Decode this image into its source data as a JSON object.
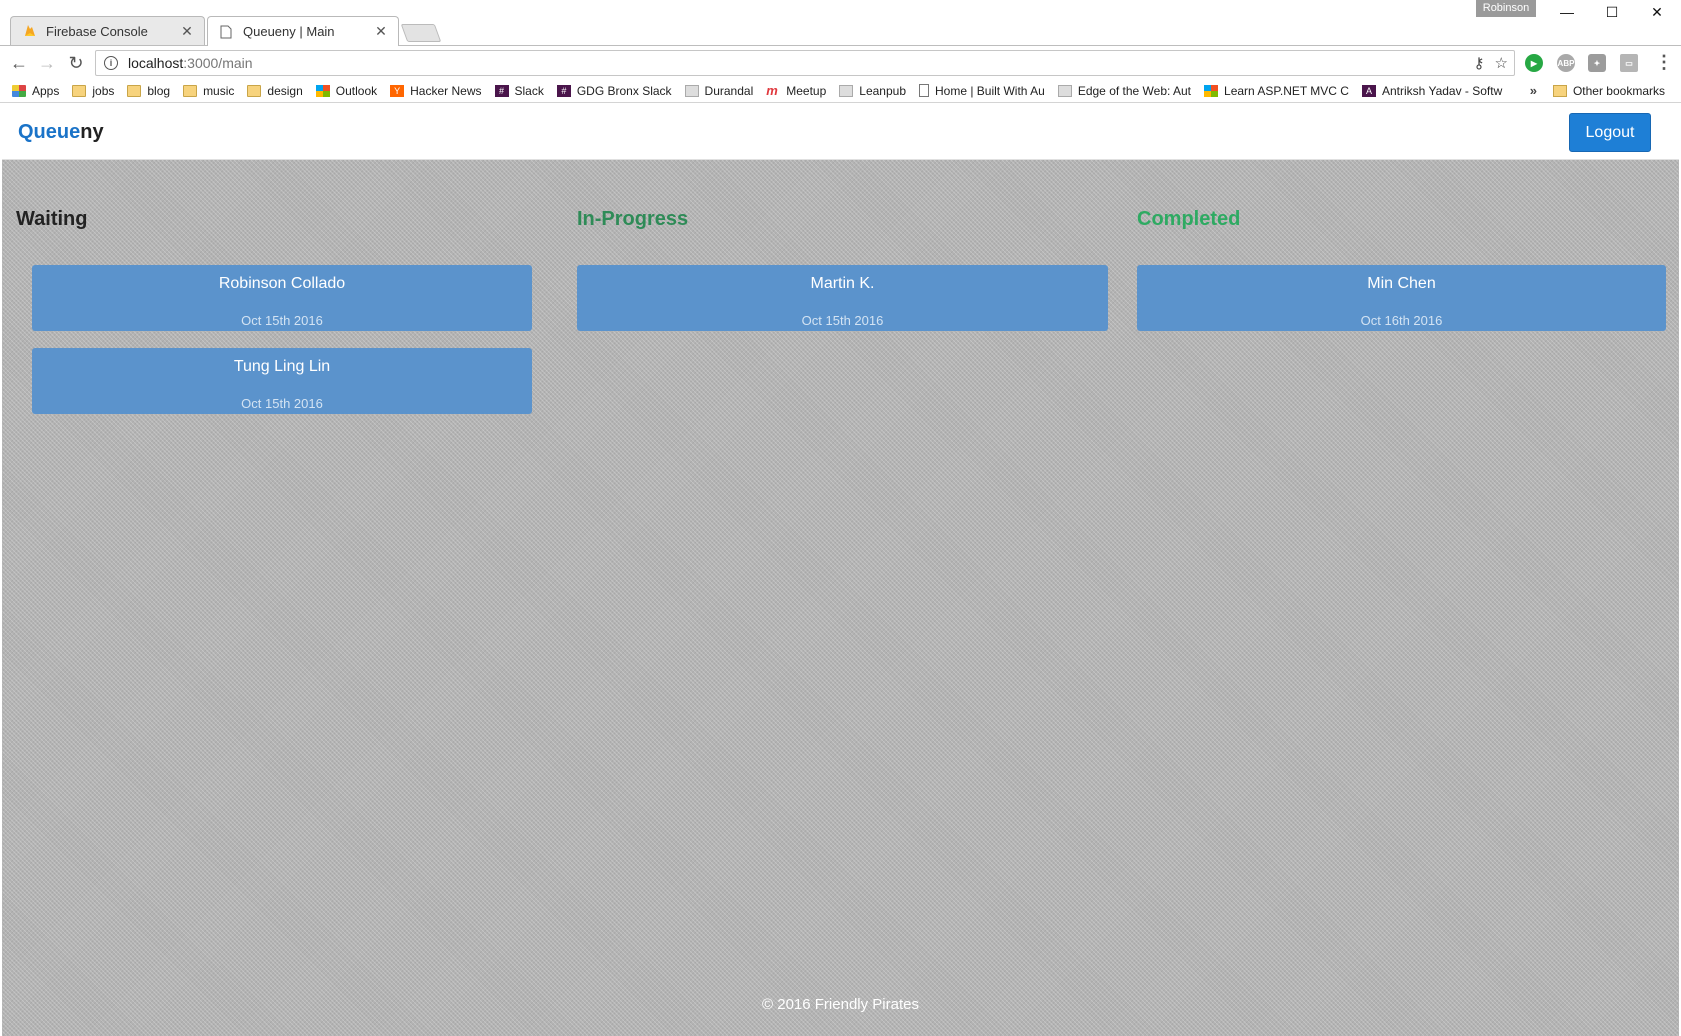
{
  "browser": {
    "tabs": [
      {
        "title": "Firebase Console"
      },
      {
        "title": "Queueny | Main"
      }
    ],
    "profile": "Robinson",
    "url_host": "localhost",
    "url_path": ":3000/main",
    "bookmarks": [
      {
        "label": "Apps",
        "icon": "apps-icon"
      },
      {
        "label": "jobs",
        "icon": "folder-icon"
      },
      {
        "label": "blog",
        "icon": "folder-icon"
      },
      {
        "label": "music",
        "icon": "folder-icon"
      },
      {
        "label": "design",
        "icon": "folder-icon"
      },
      {
        "label": "Outlook",
        "icon": "microsoft-icon"
      },
      {
        "label": "Hacker News",
        "icon": "hacker-news-icon"
      },
      {
        "label": "Slack",
        "icon": "slack-icon"
      },
      {
        "label": "GDG Bronx Slack",
        "icon": "slack-icon"
      },
      {
        "label": "Durandal",
        "icon": "durandal-icon"
      },
      {
        "label": "Meetup",
        "icon": "meetup-icon"
      },
      {
        "label": "Leanpub",
        "icon": "leanpub-icon"
      },
      {
        "label": "Home | Built With Au",
        "icon": "page-icon"
      },
      {
        "label": "Edge of the Web: Aut",
        "icon": "edge-icon"
      },
      {
        "label": "Learn ASP.NET MVC C",
        "icon": "microsoft-icon"
      },
      {
        "label": "Antriksh Yadav - Softw",
        "icon": "angular-icon"
      }
    ],
    "more_label": "»",
    "other_bookmarks": "Other bookmarks"
  },
  "app": {
    "brand_part1": "Queue",
    "brand_part2": "ny",
    "logout_label": "Logout",
    "footer": "© 2016 Friendly Pirates",
    "colors": {
      "brand_blue": "#1a73c8",
      "card": "#5b93cc",
      "status_green": "#2e8b57"
    },
    "columns": [
      {
        "title": "Waiting",
        "cards": [
          {
            "name": "Robinson Collado",
            "date": "Oct 15th 2016"
          },
          {
            "name": "Tung Ling Lin",
            "date": "Oct 15th 2016"
          }
        ]
      },
      {
        "title": "In-Progress",
        "cards": [
          {
            "name": "Martin K.",
            "date": "Oct 15th 2016"
          }
        ]
      },
      {
        "title": "Completed",
        "cards": [
          {
            "name": "Min Chen",
            "date": "Oct 16th 2016"
          }
        ]
      }
    ]
  }
}
